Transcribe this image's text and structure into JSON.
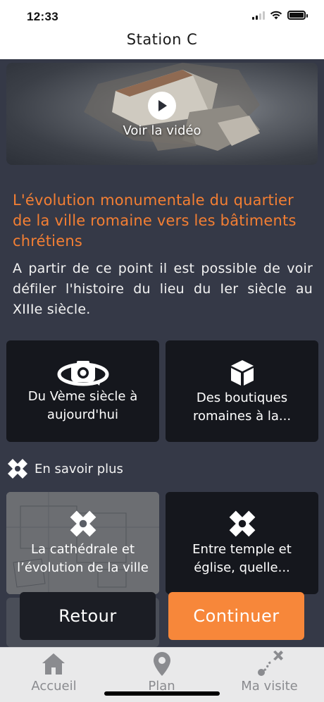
{
  "status": {
    "time": "12:33"
  },
  "nav": {
    "title": "Station C"
  },
  "video": {
    "label": "Voir la vidéo",
    "icon": "play-icon"
  },
  "content": {
    "headline": "L'évolution monumentale du quartier de la ville romaine vers les bâtiments chrétiens",
    "intro": "A partir de ce point il est possible de voir défiler l'histoire du lieu du Ier siècle au XIIIe siècle."
  },
  "tiles": [
    {
      "label": "Du Vème siècle à aujourd'hui",
      "icon": "camera-360-icon"
    },
    {
      "label": "Des boutiques romaines à la...",
      "icon": "cube-icon"
    }
  ],
  "more": {
    "label": "En savoir plus",
    "icon": "compass-cross-icon"
  },
  "more_tiles": [
    {
      "label": "La cathédrale et l’évolution de la ville",
      "icon": "compass-cross-icon"
    },
    {
      "label": "Entre temple et église, quelle...",
      "icon": "compass-cross-icon"
    }
  ],
  "buttons": {
    "back": "Retour",
    "next": "Continuer"
  },
  "tabs": [
    {
      "label": "Accueil",
      "icon": "home-icon"
    },
    {
      "label": "Plan",
      "icon": "map-pin-icon"
    },
    {
      "label": "Ma visite",
      "icon": "route-icon"
    }
  ],
  "colors": {
    "accent": "#f47f33",
    "background": "#353947",
    "tile": "#15171d",
    "continue": "#f7873a"
  }
}
